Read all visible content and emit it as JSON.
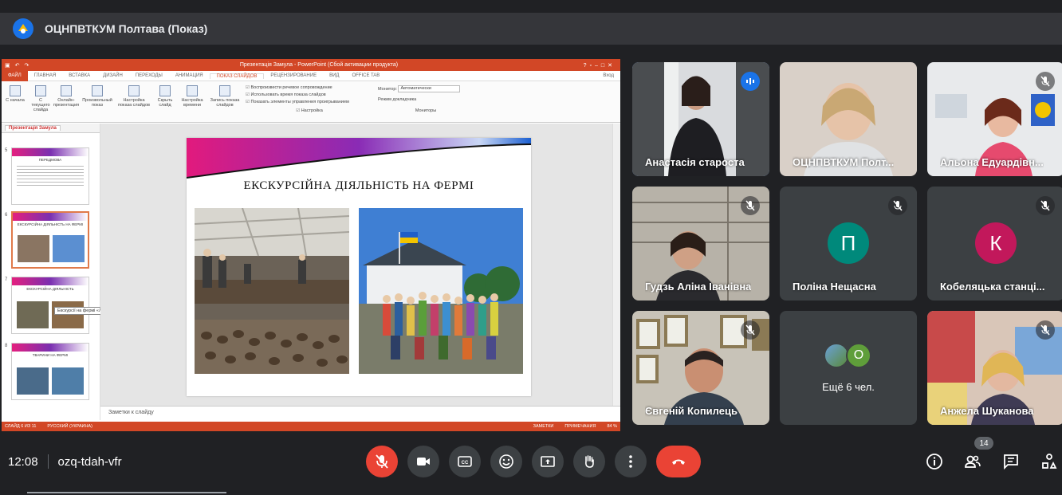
{
  "meeting": {
    "title": "ОЦНПВТКУМ Полтава (Показ)",
    "time": "12:08",
    "code": "ozq-tdah-vfr",
    "participant_count": "14"
  },
  "powerpoint": {
    "window_title": "Презентація Замула - PowerPoint (Сбой активации продукта)",
    "account": "Вход",
    "tabs": [
      "ФАЙЛ",
      "ГЛАВНАЯ",
      "ВСТАВКА",
      "ДИЗАЙН",
      "ПЕРЕХОДЫ",
      "АНИМАЦИЯ",
      "ПОКАЗ СЛАЙДОВ",
      "РЕЦЕНЗИРОВАНИЕ",
      "ВИД",
      "OFFICE TAB"
    ],
    "active_tab": "ПОКАЗ СЛАЙДОВ",
    "ribbon_buttons": [
      "С начала",
      "С текущего слайда",
      "Онлайн-презентация",
      "Произвольный показ",
      "Настройка показа слайдов",
      "Скрыть слайд",
      "Настройка времени",
      "Запись показа слайдов"
    ],
    "checks": [
      "Воспроизвести речевое сопровождение",
      "Использовать время показа слайдов",
      "Показать элементы управления проигрыванием"
    ],
    "monitor_label": "Монитор:",
    "monitor_value": "Автоматически",
    "presenter_view": "Режим докладчика",
    "group_labels": [
      "Начать показ слайдов",
      "Настройка",
      "Мониторы"
    ],
    "doc_tab": "Презентація Замула",
    "thumbnail_numbers": [
      "5",
      "6",
      "7",
      "8"
    ],
    "thumb5_title": "ПЕРЕДМОВА",
    "thumb6_title": "ЕКСКУРСІЙНА ДІЯЛЬНІСТЬ НА ФЕРМІ",
    "thumb7_title": "ЕКСКУРСІЙНА ДІЯЛЬНІСТЬ",
    "thumb8_title": "ТВАРИНИ НА ФЕРМІ",
    "tooltip": "Екскурсії на фермі «Ліса...",
    "slide_title": "ЕКСКУРСІЙНА ДІЯЛЬНІСТЬ НА ФЕРМІ",
    "notes_placeholder": "Заметки к слайду",
    "status_slide": "СЛАЙД 6 ИЗ 11",
    "status_lang": "РУССКИЙ (УКРАИНА)",
    "status_notes": "ЗАМЕТКИ",
    "status_comments": "ПРИМЕЧАНИЯ",
    "status_zoom": "84 %"
  },
  "participants": [
    {
      "name": "Анастасія староста",
      "mic": "active"
    },
    {
      "name": "ОЦНПВТКУМ Полт...",
      "mic": "none"
    },
    {
      "name": "Альона Едуардівн...",
      "mic": "muted"
    },
    {
      "name": "Гудзь Аліна Іванівна",
      "mic": "muted"
    },
    {
      "name": "Поліна Нещасна",
      "mic": "muted",
      "initial": "П",
      "color": "#00897b"
    },
    {
      "name": "Кобеляцька станці...",
      "mic": "muted",
      "initial": "К",
      "color": "#c2185b"
    },
    {
      "name": "Євгеній Копилець",
      "mic": "muted"
    },
    {
      "name": "Ещё 6 чел.",
      "initial": "О",
      "color": "#5f9e3a"
    },
    {
      "name": "Анжела Шуканова",
      "mic": "muted"
    }
  ],
  "controls": [
    "mic-off-icon",
    "camera-icon",
    "captions-icon",
    "emoji-icon",
    "present-icon",
    "raise-hand-icon",
    "more-icon",
    "hangup-icon",
    "info-icon",
    "people-icon",
    "chat-icon",
    "activities-icon"
  ],
  "colors": {
    "accent": "#8ab4f8",
    "danger": "#ea4335",
    "powerpoint": "#d24726",
    "background": "#202124"
  }
}
